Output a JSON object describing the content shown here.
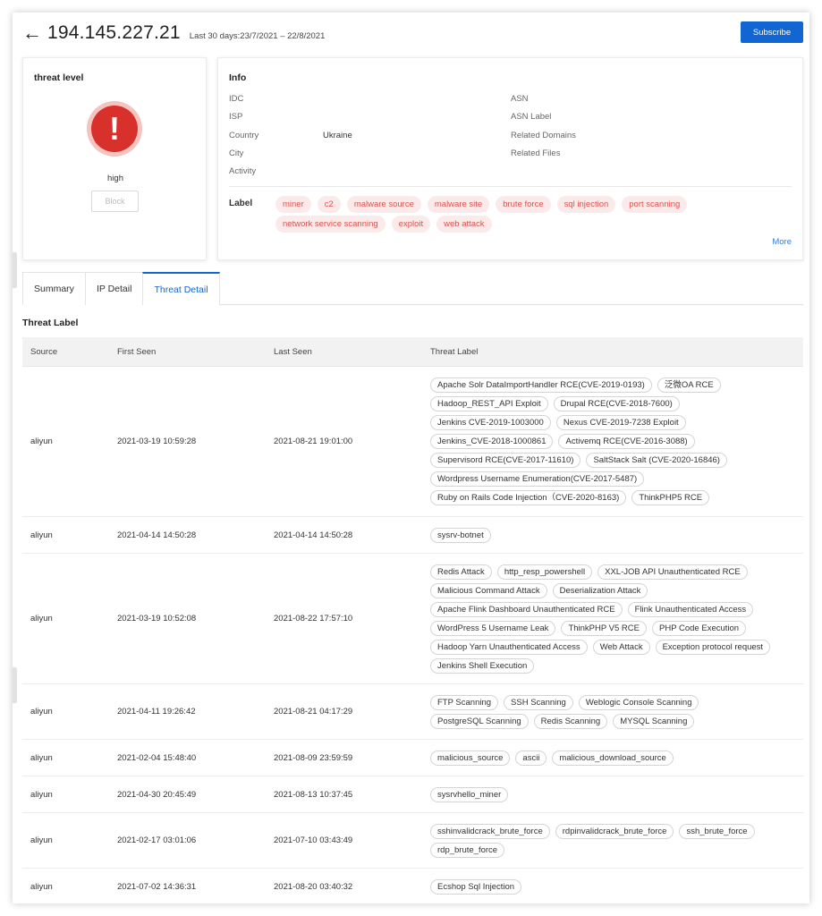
{
  "header": {
    "ip": "194.145.227.21",
    "range": "Last 30 days:23/7/2021 – 22/8/2021",
    "subscribe_label": "Subscribe"
  },
  "threat": {
    "title": "threat level",
    "level": "high",
    "block_label": "Block"
  },
  "info": {
    "title": "Info",
    "left": [
      {
        "key": "IDC",
        "value": ""
      },
      {
        "key": "ISP",
        "value": ""
      },
      {
        "key": "Country",
        "value": "Ukraine"
      },
      {
        "key": "City",
        "value": ""
      },
      {
        "key": "Activity",
        "value": ""
      }
    ],
    "right": [
      {
        "key": "ASN",
        "value": ""
      },
      {
        "key": "ASN Label",
        "value": ""
      },
      {
        "key": "Related Domains",
        "value": ""
      },
      {
        "key": "Related Files",
        "value": ""
      }
    ],
    "label_title": "Label",
    "labels": [
      "miner",
      "c2",
      "malware source",
      "malware site",
      "brute force",
      "sql injection",
      "port scanning",
      "network service scanning",
      "exploit",
      "web attack"
    ],
    "more_label": "More"
  },
  "tabs": [
    {
      "label": "Summary"
    },
    {
      "label": "IP Detail"
    },
    {
      "label": "Threat Detail"
    }
  ],
  "section_title": "Threat Label",
  "table": {
    "headers": [
      "Source",
      "First Seen",
      "Last Seen",
      "Threat Label"
    ],
    "rows": [
      {
        "source": "aliyun",
        "first": "2021-03-19 10:59:28",
        "last": "2021-08-21 19:01:00",
        "labels": [
          "Apache Solr DataImportHandler RCE(CVE-2019-0193)",
          "泛微OA RCE",
          "Hadoop_REST_API Exploit",
          "Drupal RCE(CVE-2018-7600)",
          "Jenkins CVE-2019-1003000",
          "Nexus CVE-2019-7238 Exploit",
          "Jenkins_CVE-2018-1000861",
          "Activemq RCE(CVE-2016-3088)",
          "Supervisord RCE(CVE-2017-11610)",
          "SaltStack Salt (CVE-2020-16846)",
          "Wordpress Username Enumeration(CVE-2017-5487)",
          "Ruby on Rails Code Injection（CVE-2020-8163)",
          "ThinkPHP5 RCE"
        ]
      },
      {
        "source": "aliyun",
        "first": "2021-04-14 14:50:28",
        "last": "2021-04-14 14:50:28",
        "labels": [
          "sysrv-botnet"
        ]
      },
      {
        "source": "aliyun",
        "first": "2021-03-19 10:52:08",
        "last": "2021-08-22 17:57:10",
        "labels": [
          "Redis Attack",
          "http_resp_powershell",
          "XXL-JOB API Unauthenticated RCE",
          "Malicious Command Attack",
          "Deserialization Attack",
          "Apache Flink Dashboard Unauthenticated RCE",
          "Flink Unauthenticated Access",
          "WordPress 5 Username Leak",
          "ThinkPHP V5 RCE",
          "PHP Code Execution",
          "Hadoop Yarn Unauthenticated Access",
          "Web Attack",
          "Exception protocol request",
          "Jenkins Shell Execution"
        ]
      },
      {
        "source": "aliyun",
        "first": "2021-04-11 19:26:42",
        "last": "2021-08-21 04:17:29",
        "labels": [
          "FTP Scanning",
          "SSH Scanning",
          "Weblogic Console Scanning",
          "PostgreSQL Scanning",
          "Redis Scanning",
          "MYSQL Scanning"
        ]
      },
      {
        "source": "aliyun",
        "first": "2021-02-04 15:48:40",
        "last": "2021-08-09 23:59:59",
        "labels": [
          "malicious_source",
          "ascii",
          "malicious_download_source"
        ]
      },
      {
        "source": "aliyun",
        "first": "2021-04-30 20:45:49",
        "last": "2021-08-13 10:37:45",
        "labels": [
          "sysrvhello_miner"
        ]
      },
      {
        "source": "aliyun",
        "first": "2021-02-17 03:01:06",
        "last": "2021-07-10 03:43:49",
        "labels": [
          "sshinvalidcrack_brute_force",
          "rdpinvalidcrack_brute_force",
          "ssh_brute_force",
          "rdp_brute_force"
        ]
      },
      {
        "source": "aliyun",
        "first": "2021-07-02 14:36:31",
        "last": "2021-08-20 03:40:32",
        "labels": [
          "Ecshop Sql Injection"
        ]
      }
    ]
  }
}
